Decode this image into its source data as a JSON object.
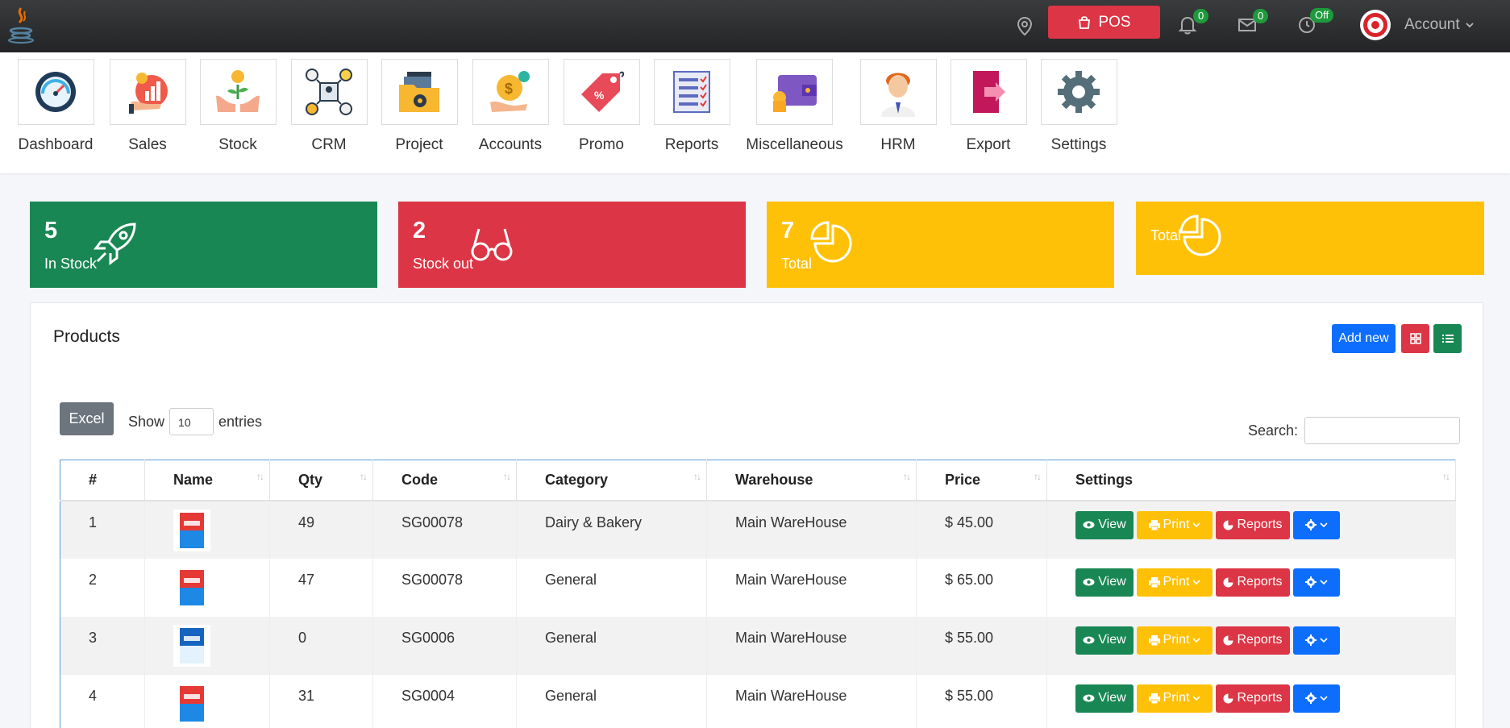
{
  "topbar": {
    "pos_label": "POS",
    "notifications_count": "0",
    "messages_count": "0",
    "clock_status": "Off",
    "account_label": "Account"
  },
  "modules": [
    {
      "label": "Dashboard",
      "icon": "dashboard-gauge-icon"
    },
    {
      "label": "Sales",
      "icon": "sales-chart-icon"
    },
    {
      "label": "Stock",
      "icon": "stock-plant-icon"
    },
    {
      "label": "CRM",
      "icon": "crm-network-icon"
    },
    {
      "label": "Project",
      "icon": "project-folder-icon"
    },
    {
      "label": "Accounts",
      "icon": "accounts-coin-icon"
    },
    {
      "label": "Promo",
      "icon": "promo-tag-icon"
    },
    {
      "label": "Reports",
      "icon": "reports-checklist-icon"
    },
    {
      "label": "Miscellaneous",
      "icon": "wallet-icon"
    },
    {
      "label": "HRM",
      "icon": "person-icon"
    },
    {
      "label": "Export",
      "icon": "export-icon"
    },
    {
      "label": "Settings",
      "icon": "gear-icon"
    }
  ],
  "stats": [
    {
      "value": "5",
      "caption": "In Stock",
      "color": "#198754"
    },
    {
      "value": "2",
      "caption": "Stock out",
      "color": "#dc3545"
    },
    {
      "value": "7",
      "caption": "Total",
      "color": "#ffc107"
    },
    {
      "value": "",
      "caption": "Total",
      "color": "#ffc107"
    }
  ],
  "products": {
    "title": "Products",
    "add_new_label": "Add new",
    "excel_label": "Excel",
    "show_label": "Show",
    "entries_value": "10",
    "entries_label": "entries",
    "search_label": "Search:",
    "columns": [
      "#",
      "Name",
      "Qty",
      "Code",
      "Category",
      "Warehouse",
      "Price",
      "Settings"
    ],
    "rows": [
      {
        "num": "1",
        "qty": "49",
        "code": "SG00078",
        "category": "Dairy & Bakery",
        "warehouse": "Main WareHouse",
        "price": "$ 45.00",
        "image": "red-sugar-pack"
      },
      {
        "num": "2",
        "qty": "47",
        "code": "SG00078",
        "category": "General",
        "warehouse": "Main WareHouse",
        "price": "$ 65.00",
        "image": "red-sugar-pack"
      },
      {
        "num": "3",
        "qty": "0",
        "code": "SG0006",
        "category": "General",
        "warehouse": "Main WareHouse",
        "price": "$ 55.00",
        "image": "blue-salt-pack"
      },
      {
        "num": "4",
        "qty": "31",
        "code": "SG0004",
        "category": "General",
        "warehouse": "Main WareHouse",
        "price": "$ 55.00",
        "image": "red-sugar-pack"
      }
    ],
    "actions": {
      "view": "View",
      "print": "Print",
      "reports": "Reports"
    }
  }
}
